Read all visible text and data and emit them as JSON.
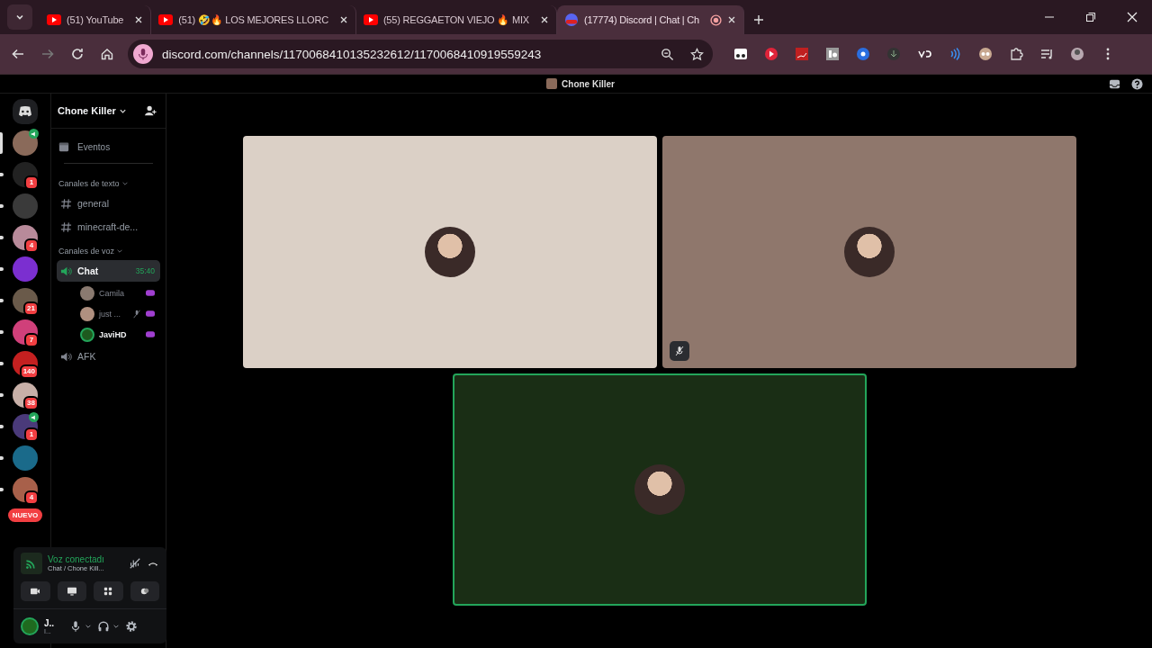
{
  "browser": {
    "tabs": [
      {
        "title": "(51) YouTube",
        "kind": "youtube",
        "selected": false
      },
      {
        "title": "(51) 🤣🔥 LOS MEJORES LLORC",
        "kind": "youtube",
        "selected": false
      },
      {
        "title": "(55) REGGAETON VIEJO 🔥 MIX",
        "kind": "youtube",
        "selected": false
      },
      {
        "title": "(17774) Discord | Chat | Ch",
        "kind": "discord",
        "selected": true
      }
    ],
    "url": "discord.com/channels/1170068410135232612/1170068410919559243"
  },
  "titlebar": {
    "title": "Chone Killer"
  },
  "servers": [
    {
      "color": "#8a6a5a",
      "selected": true,
      "speaker": true
    },
    {
      "badge": "1",
      "color": "#222222",
      "selected": false,
      "speaker": false
    },
    {
      "color": "#3a3a3a",
      "selected": false,
      "speaker": false
    },
    {
      "badge": "4",
      "color": "#b88a9a",
      "selected": false,
      "speaker": false
    },
    {
      "color": "#7b2fd0",
      "selected": false,
      "speaker": false
    },
    {
      "badge": "21",
      "color": "#6a5a4a",
      "selected": false,
      "speaker": false
    },
    {
      "badge": "7",
      "color": "#d0407a",
      "selected": false,
      "speaker": false
    },
    {
      "badge": "140",
      "color": "#c42020",
      "selected": false,
      "speaker": false
    },
    {
      "badge": "38",
      "color": "#c8b0a8",
      "selected": false,
      "speaker": false
    },
    {
      "badge": "1",
      "color": "#4a3a7a",
      "selected": false,
      "speaker": true
    },
    {
      "color": "#1a6a8a",
      "selected": false,
      "speaker": false
    },
    {
      "badge": "4",
      "color": "#a8604a",
      "selected": false,
      "speaker": false
    }
  ],
  "new_pill": "NUEVO",
  "sidebar": {
    "server_name": "Chone Killer",
    "events": "Eventos",
    "categories": [
      {
        "name": "Canales de texto",
        "channels": [
          {
            "name": "general",
            "kind": "text",
            "selected": false
          },
          {
            "name": "minecraft-de...",
            "kind": "text",
            "selected": false
          }
        ]
      },
      {
        "name": "Canales de voz",
        "channels": [
          {
            "name": "Chat",
            "kind": "voice",
            "selected": true,
            "timer": "35:40",
            "users": [
              {
                "name": "Camila",
                "muted": false,
                "speaking": false,
                "color": "#8a7a70"
              },
              {
                "name": "just ...",
                "muted": true,
                "speaking": false,
                "color": "#b09080"
              },
              {
                "name": "JaviHD",
                "muted": false,
                "speaking": true,
                "color": "#1e5a1e"
              }
            ]
          },
          {
            "name": "AFK",
            "kind": "voice",
            "selected": false
          }
        ]
      }
    ]
  },
  "voice_panel": {
    "status": "Voz conectadı",
    "channel": "Chat / Chone Kill..."
  },
  "user_panel": {
    "name": "J..",
    "tag": "I..."
  },
  "tiles": [
    {
      "color": "#dbd0c6",
      "muted": false,
      "speaking": false
    },
    {
      "color": "#8f776c",
      "muted": true,
      "speaking": false
    },
    {
      "color": "#1a2e15",
      "muted": false,
      "speaking": true
    }
  ]
}
